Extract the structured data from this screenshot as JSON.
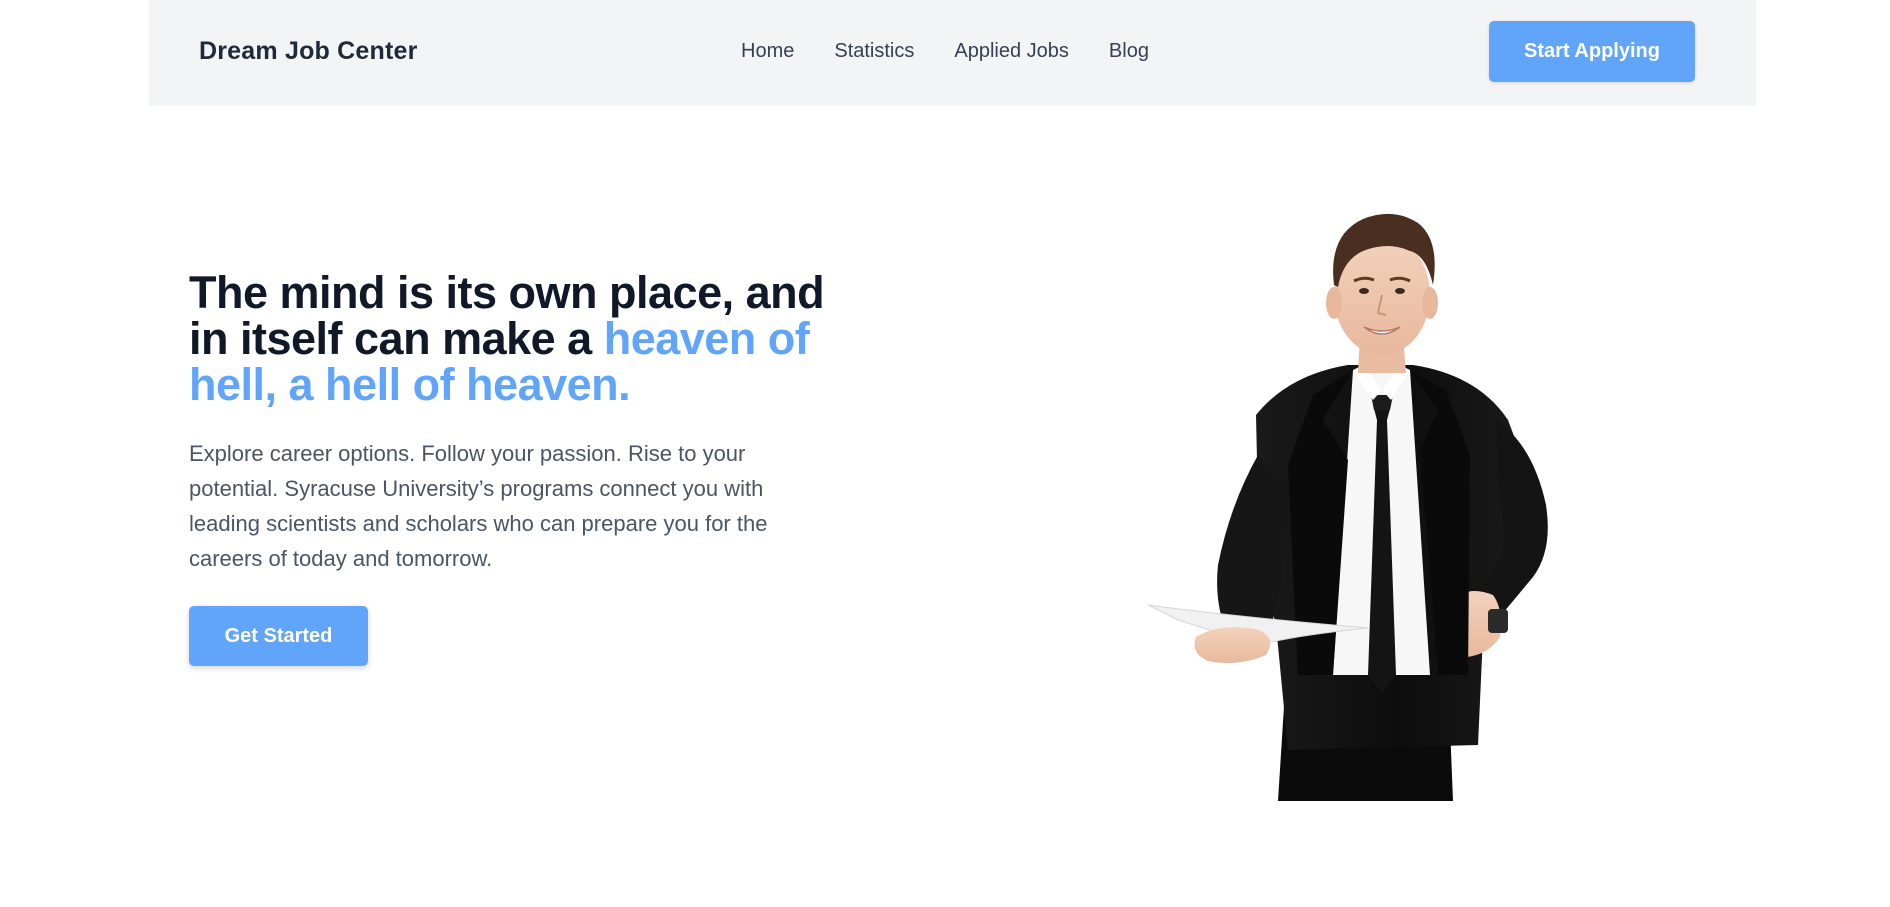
{
  "header": {
    "brand": "Dream Job Center",
    "nav": [
      "Home",
      "Statistics",
      "Applied Jobs",
      "Blog"
    ],
    "cta_label": "Start Applying"
  },
  "hero": {
    "title_plain": "The mind is its own place, and in itself can make a ",
    "title_accent": "heaven of hell, a hell of heaven.",
    "description": "Explore career options. Follow your passion. Rise to your potential. Syracuse University’s programs connect you with leading scientists and scholars who can prepare you for the careers of today and tomorrow.",
    "cta_label": "Get Started",
    "image_subject": "smiling businessman in black suit holding paper"
  },
  "colors": {
    "accent": "#60a5fa",
    "nav_bg": "#f3f4f6",
    "heading": "#111827",
    "body_text": "#4b5563"
  }
}
